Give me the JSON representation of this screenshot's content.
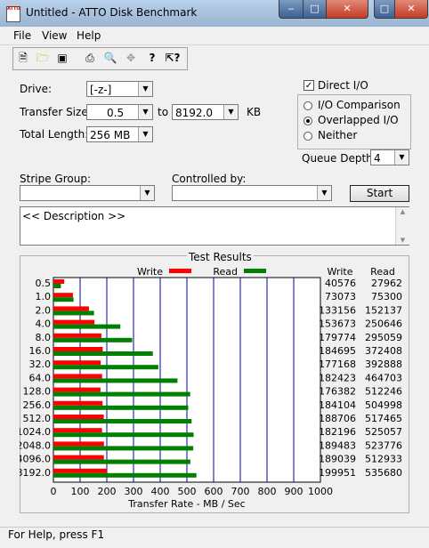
{
  "window": {
    "title": "Untitled - ATTO Disk Benchmark",
    "icon_text": "ATTO"
  },
  "menu": [
    "File",
    "View",
    "Help"
  ],
  "toolbar": [
    "new-icon",
    "open-icon",
    "save-icon",
    "print-icon",
    "print-preview-icon",
    "move-icon",
    "help-icon",
    "context-help-icon"
  ],
  "form": {
    "drive_label": "Drive:",
    "drive_value": "[-z-]",
    "transfer_size_label": "Transfer Size:",
    "transfer_from": "0.5",
    "to_label": "to",
    "transfer_to": "8192.0",
    "kb_label": "KB",
    "total_length_label": "Total Length:",
    "total_length_value": "256 MB",
    "direct_io_label": "Direct I/O",
    "direct_io_checked": true,
    "io_options": [
      "I/O Comparison",
      "Overlapped I/O",
      "Neither"
    ],
    "io_selected": "Overlapped I/O",
    "queue_depth_label": "Queue Depth:",
    "queue_depth_value": "4",
    "stripe_group_label": "Stripe Group:",
    "controlled_by_label": "Controlled by:",
    "start_label": "Start",
    "description_text": "<< Description >>"
  },
  "chart_data": {
    "type": "bar",
    "title": "Test Results",
    "xlabel": "Transfer Rate - MB / Sec",
    "xlim": [
      0,
      1000
    ],
    "xticks": [
      0,
      100,
      200,
      300,
      400,
      500,
      600,
      700,
      800,
      900,
      1000
    ],
    "categories": [
      "0.5",
      "1.0",
      "2.0",
      "4.0",
      "8.0",
      "16.0",
      "32.0",
      "64.0",
      "128.0",
      "256.0",
      "512.0",
      "1024.0",
      "2048.0",
      "4096.0",
      "8192.0"
    ],
    "series": [
      {
        "name": "Write",
        "color": "#ff0000",
        "values": [
          40576,
          73073,
          133156,
          153673,
          179774,
          184695,
          177168,
          182423,
          176382,
          184104,
          188706,
          182196,
          189483,
          189039,
          199951
        ]
      },
      {
        "name": "Read",
        "color": "#008000",
        "values": [
          27962,
          75300,
          152137,
          250646,
          295059,
          372408,
          392888,
          464703,
          512246,
          504998,
          517465,
          525057,
          523776,
          512933,
          535680
        ]
      }
    ],
    "column_headers": [
      "Write",
      "Read"
    ]
  },
  "status": "For Help, press F1"
}
